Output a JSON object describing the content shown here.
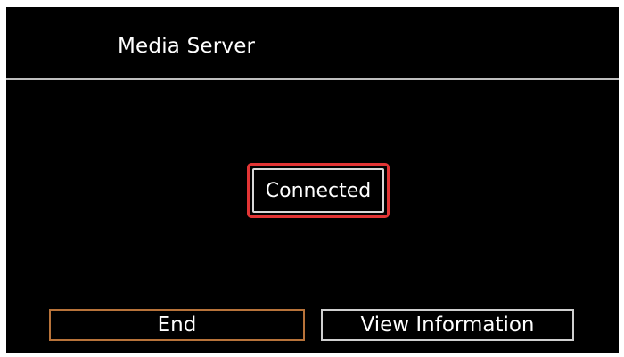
{
  "header": {
    "title": "Media Server"
  },
  "status": {
    "text": "Connected"
  },
  "buttons": {
    "end_label": "End",
    "view_info_label": "View Information"
  },
  "colors": {
    "background": "#000000",
    "text": "#ffffff",
    "highlight_border": "#e23535",
    "selected_button_border": "#b8733a",
    "button_border": "#cfcfcf"
  }
}
